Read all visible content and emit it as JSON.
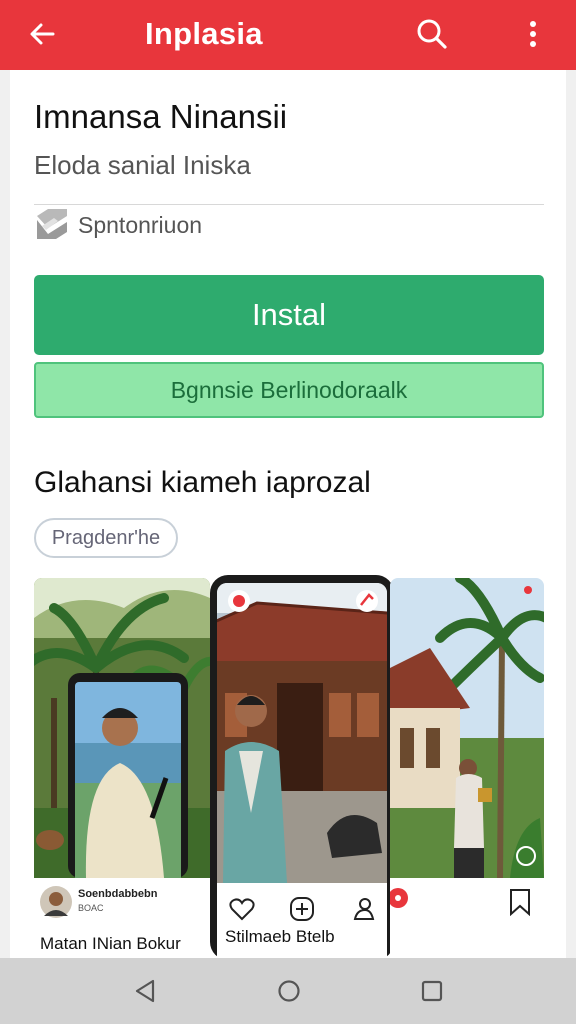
{
  "topbar": {
    "title": "Inplasia",
    "back_icon": "arrow-left-icon",
    "search_icon": "search-icon",
    "more_icon": "more-vertical-icon",
    "color": "#e8363c"
  },
  "app": {
    "name": "Imnansa Ninansii",
    "subtitle": "Eloda sanial Iniska",
    "developer": "Spntonriuon",
    "install_label": "Instal",
    "secondary_label": "Bgnnsie Berlinodoraalk",
    "install_color": "#2eab6e",
    "secondary_color": "#8fe6a8"
  },
  "screenshots_section": {
    "title": "Glahansi kiameh iaprozal",
    "chip_label": "Pragdenr'he",
    "items": [
      {
        "caption": "Matan INian Bokur",
        "user_name": "Soenbdabbebn",
        "user_sub": "BOAC"
      },
      {
        "caption": "Stilmaeb Btelb"
      },
      {
        "caption": ""
      }
    ]
  },
  "navbar": {
    "back_icon": "nav-back-icon",
    "home_icon": "nav-home-icon",
    "recents_icon": "nav-recents-icon"
  }
}
